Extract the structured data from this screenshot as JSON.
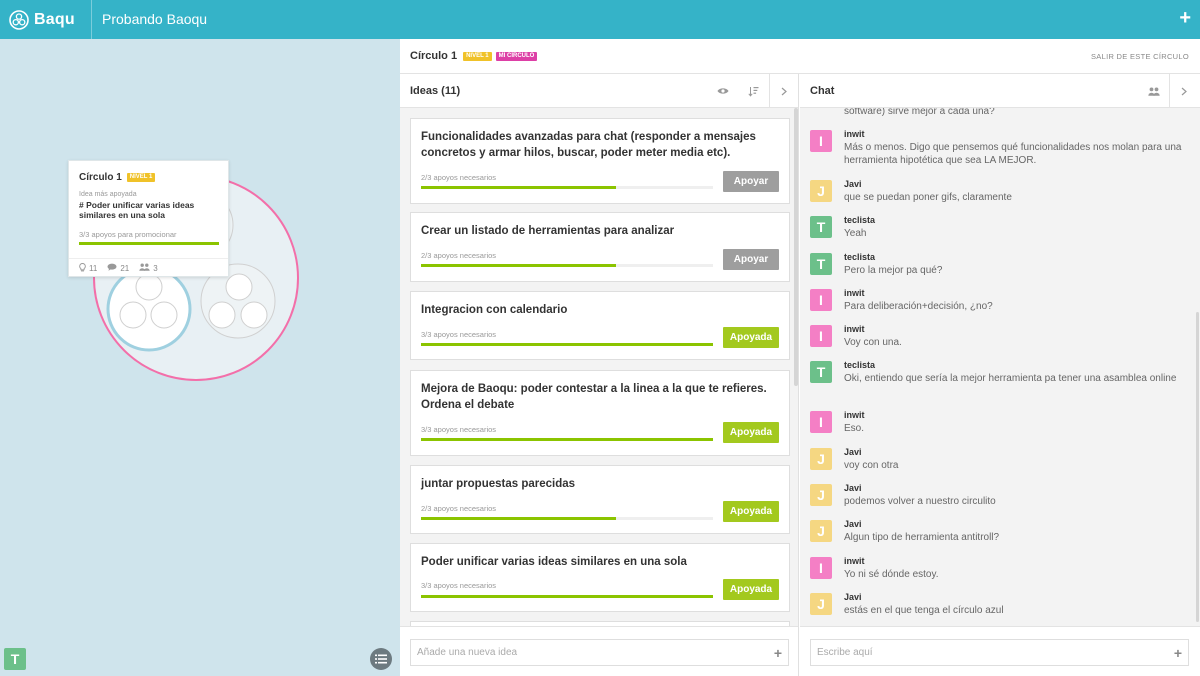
{
  "app": {
    "name": "Baqu",
    "project_title": "Probando Baoqu",
    "add_label": "+"
  },
  "map": {
    "card": {
      "title": "Círculo 1",
      "badge": "NIVEL 1",
      "sub": "Idea más apoyada",
      "idea": "# Poder unificar varias ideas similares en una sola",
      "support": "3/3 apoyos para promocionar",
      "support_fraction": 1.0,
      "stats": {
        "ideas": "11",
        "comments": "21",
        "members": "3"
      }
    },
    "user_initial": "T"
  },
  "circle": {
    "title": "Círculo 1",
    "level_badge": "NIVEL 1",
    "mine_badge": "MI CÍRCULO",
    "leave": "SALIR DE ESTE CÍRCULO"
  },
  "ideas": {
    "header": "Ideas (11)",
    "input_placeholder": "Añade una nueva idea",
    "input_add": "+",
    "items": [
      {
        "title": "Funcionalidades avanzadas para chat (responder a mensajes concretos y armar hilos, buscar, poder meter media etc).",
        "support": "2/3 apoyos necesarios",
        "fraction": 0.667,
        "action": "Apoyar",
        "supported": false
      },
      {
        "title": "Crear un listado de herramientas para analizar",
        "support": "2/3 apoyos necesarios",
        "fraction": 0.667,
        "action": "Apoyar",
        "supported": false
      },
      {
        "title": "Integracion con calendario",
        "support": "3/3 apoyos necesarios",
        "fraction": 1.0,
        "action": "Apoyada",
        "supported": true
      },
      {
        "title": "Mejora de Baoqu: poder contestar a la linea a la que te refieres. Ordena el debate",
        "support": "3/3 apoyos necesarios",
        "fraction": 1.0,
        "action": "Apoyada",
        "supported": true
      },
      {
        "title": "juntar propuestas parecidas",
        "support": "2/3 apoyos necesarios",
        "fraction": 0.667,
        "action": "Apoyada",
        "supported": true
      },
      {
        "title": "Poder unificar varias ideas similares en una sola",
        "support": "3/3 apoyos necesarios",
        "fraction": 1.0,
        "action": "Apoyada",
        "supported": true
      }
    ]
  },
  "chat": {
    "header": "Chat",
    "input_placeholder": "Escribe aquí",
    "input_add": "+",
    "partial_top": "software) sirve mejor a cada una?",
    "messages": [
      {
        "initial": "I",
        "author": "inwit",
        "text": "Más o menos. Digo que pensemos qué funcionalidades nos molan para una herramienta hipotética que sea LA MEJOR."
      },
      {
        "initial": "J",
        "author": "Javi",
        "text": "que se puedan poner gifs, claramente"
      },
      {
        "initial": "T",
        "author": "teclista",
        "text": "Yeah"
      },
      {
        "initial": "T",
        "author": "teclista",
        "text": "Pero la mejor pa qué?"
      },
      {
        "initial": "I",
        "author": "inwit",
        "text": "Para deliberación+decisión, ¿no?"
      },
      {
        "initial": "I",
        "author": "inwit",
        "text": "Voy con una."
      },
      {
        "initial": "T",
        "author": "teclista",
        "text": "Oki, entiendo que sería la mejor herramienta pa tener una asamblea online"
      },
      {
        "initial": "I",
        "author": "inwit",
        "text": "Eso."
      },
      {
        "initial": "J",
        "author": "Javi",
        "text": "voy con otra"
      },
      {
        "initial": "J",
        "author": "Javi",
        "text": "podemos volver a nuestro circulito"
      },
      {
        "initial": "J",
        "author": "Javi",
        "text": "Algun tipo de herramienta antitroll?"
      },
      {
        "initial": "I",
        "author": "inwit",
        "text": "Yo ni sé dónde estoy."
      },
      {
        "initial": "J",
        "author": "Javi",
        "text": "estás en el que tenga el círculo azul"
      }
    ]
  },
  "colors": {
    "primary": "#35b3c8",
    "green": "#a3c91e",
    "gray_button": "#9e9e9e",
    "level_badge": "#f0c229",
    "mine_badge": "#dd3fa6",
    "avatar_I": "#f47fc5",
    "avatar_J": "#f5d782",
    "avatar_T": "#6cc08a"
  }
}
